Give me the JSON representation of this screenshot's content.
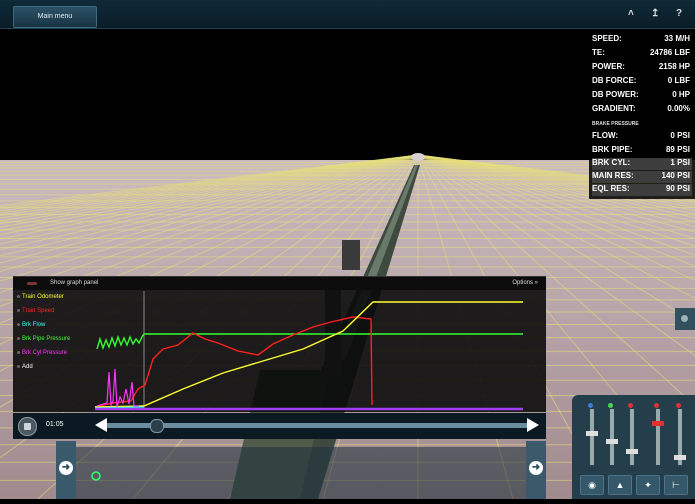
{
  "topbar": {
    "main_menu_label": "Main menu",
    "icons": [
      "caret-up-icon",
      "anchor-icon",
      "help-icon"
    ],
    "help_label": "?"
  },
  "hud": {
    "rows": [
      {
        "k": "SPEED:",
        "v": "33 M/H"
      },
      {
        "k": "TE:",
        "v": "24786 LBF"
      },
      {
        "k": "POWER:",
        "v": "2158 HP"
      },
      {
        "k": "DB FORCE:",
        "v": "0 LBF"
      },
      {
        "k": "DB POWER:",
        "v": "0 HP"
      },
      {
        "k": "GRADIENT:",
        "v": "0.00%"
      }
    ],
    "brake_header": "BRAKE PRESSURE",
    "brake_rows": [
      {
        "k": "FLOW:",
        "v": "0 PSI"
      },
      {
        "k": "BRK PIPE:",
        "v": "89 PSI"
      },
      {
        "k": "BRK CYL:",
        "v": "1 PSI"
      },
      {
        "k": "MAIN RES:",
        "v": "140 PSI"
      },
      {
        "k": "EQL RES:",
        "v": "90 PSI"
      }
    ]
  },
  "graph_panel": {
    "title": "Show graph panel",
    "options_label": "Options »",
    "legend": [
      {
        "label": "Train Odometer",
        "color": "#ffff33"
      },
      {
        "label": "Train Speed",
        "color": "#ff2020"
      },
      {
        "label": "Brk Flow",
        "color": "#33ffff"
      },
      {
        "label": "Brk Pipe Pressure",
        "color": "#33ff33"
      },
      {
        "label": "Brk Cyl Pressure",
        "color": "#ff33ff"
      },
      {
        "label": "Add",
        "color": "#ffffff"
      }
    ]
  },
  "timeline": {
    "time": "01:05",
    "progress": 0.12
  },
  "colors": {
    "topbar": "#0f2a38",
    "grid": "#e8e07a",
    "ground": "#b4a0a4",
    "panel": "#243e4c"
  }
}
